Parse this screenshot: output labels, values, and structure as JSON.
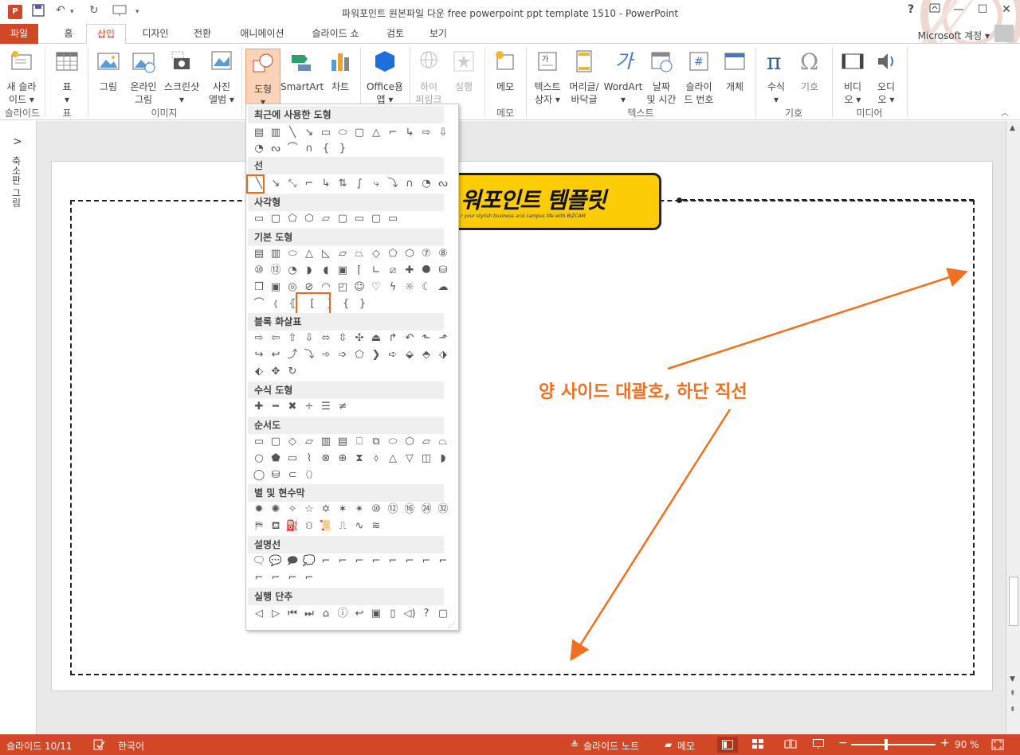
{
  "window": {
    "title": "파워포인트 원본파일 다운 free powerpoint ppt template 1510 - PowerPoint",
    "app_badge": "P",
    "help": "?",
    "buttons": [
      "▢",
      "—",
      "☐",
      "✕"
    ]
  },
  "quick_access": {
    "save_icon": "save-icon",
    "undo": "↶",
    "redo": "↻",
    "more": "▾"
  },
  "tabs": [
    {
      "label": "파일"
    },
    {
      "label": "홈"
    },
    {
      "label": "삽입"
    },
    {
      "label": "디자인"
    },
    {
      "label": "전환"
    },
    {
      "label": "애니메이션"
    },
    {
      "label": "슬라이드 쇼"
    },
    {
      "label": "검토"
    },
    {
      "label": "보기"
    }
  ],
  "account": "Microsoft 계정 ▾",
  "ribbon": {
    "new_slide": "새 슬라\n이드 ▾",
    "table": "표\n▾",
    "picture": "그림",
    "online_picture": "온라인\n그림",
    "screenshot": "스크린샷\n▾",
    "photo_album": "사진\n앨범 ▾",
    "shapes": "도형\n▾",
    "smartart": "SmartArt",
    "chart": "차트",
    "office_apps": "Office용\n앱 ▾",
    "hyperlink": "하이\n퍼링크",
    "action": "실행",
    "comment": "메모",
    "textbox": "텍스트\n상자 ▾",
    "header_footer": "머리글/\n바닥글",
    "wordart": "WordArt\n▾",
    "datetime": "날짜\n및 시간",
    "slide_number": "슬라이\n드 번호",
    "object": "개체",
    "equation": "수식\n▾",
    "symbol": "기호",
    "video": "비디\n오 ▾",
    "audio": "오디\n오 ▾",
    "groups": {
      "slides": "슬라이드",
      "tables": "표",
      "images": "이미지",
      "comments": "메모",
      "text": "텍스트",
      "symbols": "기호",
      "media": "미디어"
    }
  },
  "left_pane": {
    "expand": ">",
    "label": "축소판 그림"
  },
  "shapes_menu": {
    "sections": {
      "recent": "최근에 사용한 도형",
      "lines": "선",
      "rectangles": "사각형",
      "basic": "기본 도형",
      "block_arrows": "블록 화살표",
      "equation": "수식 도형",
      "flowchart": "순서도",
      "stars": "별 및 현수막",
      "callouts": "설명선",
      "action_buttons": "실행 단추"
    }
  },
  "slide": {
    "banner_title": "워포인트 템플릿",
    "banner_subtitle": "r your stylish business and campus life with BIZCAM",
    "annotation": "양 사이드 대괄호, 하단 직선"
  },
  "status": {
    "slide_info": "슬라이드 10/11",
    "language": "한국어",
    "notes": "슬라이드 노트",
    "comments": "메모",
    "zoom": "90 %",
    "zoom_minus": "−",
    "zoom_plus": "+"
  },
  "colors": {
    "accent": "#d24726",
    "annotation": "#f07020",
    "banner": "#fccc07"
  }
}
